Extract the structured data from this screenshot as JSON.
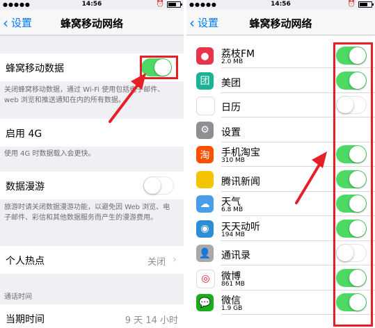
{
  "status": {
    "signal_dots": "●●●●●",
    "time": "14:56"
  },
  "left_screen": {
    "back_label": "设置",
    "title": "蜂窝移动网络",
    "cellular_data": {
      "label": "蜂窝移动数据",
      "on": true
    },
    "cellular_footer": "关闭蜂窝移动数据，通过 Wi-Fi 使用包括电子邮件、web 浏览和推送通知在内的所有数据。",
    "enable_4g": {
      "label": "启用 4G"
    },
    "footer_4g": "使用 4G 时数据载入会更快。",
    "roaming": {
      "label": "数据漫游",
      "on": false
    },
    "roaming_footer": "旅游时请关闭数据漫游功能，以避免因 Web 浏览、电子邮件、彩信和其他数据服务而产生的漫游费用。",
    "hotspot": {
      "label": "个人热点",
      "value": "关闭"
    },
    "section_call_time": "通话时间",
    "current_period": {
      "label": "当期时间",
      "value": "9 天 14 小时"
    }
  },
  "right_screen": {
    "back_label": "设置",
    "title": "蜂窝移动网络",
    "apps": [
      {
        "name": "荔枝FM",
        "size": "2.0 MB",
        "on": true,
        "icon": "lizhi-fm-icon",
        "color": "#e8334a",
        "glyph": "●"
      },
      {
        "name": "美团",
        "size": "",
        "on": true,
        "icon": "meituan-icon",
        "color": "#1ab394",
        "glyph": "团"
      },
      {
        "name": "日历",
        "size": "",
        "on": false,
        "icon": "calendar-icon",
        "color": "#ffffff",
        "glyph": ""
      },
      {
        "name": "设置",
        "size": "",
        "on": null,
        "icon": "settings-gear-icon",
        "color": "#8e8e93",
        "glyph": "⚙"
      },
      {
        "name": "手机淘宝",
        "size": "310 MB",
        "on": true,
        "icon": "taobao-icon",
        "color": "#ff5000",
        "glyph": "淘"
      },
      {
        "name": "腾讯新闻",
        "size": "",
        "on": true,
        "icon": "tencent-news-icon",
        "color": "#f5c400",
        "glyph": ""
      },
      {
        "name": "天气",
        "size": "6.8 MB",
        "on": true,
        "icon": "weather-icon",
        "color": "#4a9de8",
        "glyph": "☁"
      },
      {
        "name": "天天动听",
        "size": "194 MB",
        "on": true,
        "icon": "ttpod-icon",
        "color": "#2c8fd6",
        "glyph": "◉"
      },
      {
        "name": "通讯录",
        "size": "",
        "on": false,
        "icon": "contacts-icon",
        "color": "#a8a8ad",
        "glyph": "👤"
      },
      {
        "name": "微博",
        "size": "861 MB",
        "on": true,
        "icon": "weibo-icon",
        "color": "#ffffff",
        "glyph": "◎"
      },
      {
        "name": "微信",
        "size": "1.9 GB",
        "on": true,
        "icon": "wechat-icon",
        "color": "#1aad19",
        "glyph": "💬"
      }
    ]
  },
  "colors": {
    "switch_on": "#4cd964",
    "ios_blue": "#007aff",
    "highlight_red": "#e41f26"
  }
}
